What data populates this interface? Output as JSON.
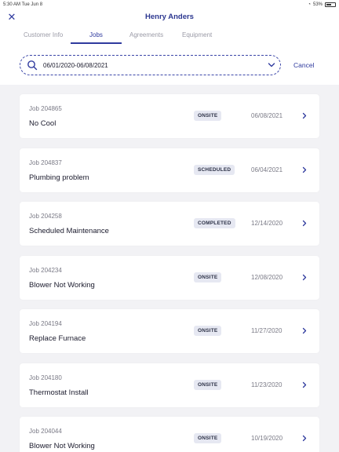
{
  "status_bar": {
    "time": "5:30 AM  Tue Jun 8",
    "battery": "53%"
  },
  "header": {
    "title": "Henry Anders"
  },
  "tabs": [
    {
      "label": "Customer Info",
      "active": false
    },
    {
      "label": "Jobs",
      "active": true
    },
    {
      "label": "Agreements",
      "active": false
    },
    {
      "label": "Equipment",
      "active": false
    }
  ],
  "search": {
    "value": "06/01/2020-06/08/2021",
    "cancel_label": "Cancel"
  },
  "jobs": [
    {
      "number": "Job 204865",
      "title": "No Cool",
      "status": "ONSITE",
      "date": "06/08/2021"
    },
    {
      "number": "Job 204837",
      "title": "Plumbing problem",
      "status": "SCHEDULED",
      "date": "06/04/2021"
    },
    {
      "number": "Job 204258",
      "title": "Scheduled Maintenance",
      "status": "COMPLETED",
      "date": "12/14/2020"
    },
    {
      "number": "Job 204234",
      "title": "Blower Not Working",
      "status": "ONSITE",
      "date": "12/08/2020"
    },
    {
      "number": "Job 204194",
      "title": "Replace Furnace",
      "status": "ONSITE",
      "date": "11/27/2020"
    },
    {
      "number": "Job 204180",
      "title": "Thermostat Install",
      "status": "ONSITE",
      "date": "11/23/2020"
    },
    {
      "number": "Job 204044",
      "title": "Blower Not Working",
      "status": "ONSITE",
      "date": "10/19/2020"
    }
  ],
  "icons": {
    "close": "close-icon",
    "search": "search-icon",
    "dropdown": "chevron-down-icon",
    "row": "chevron-right-icon"
  },
  "colors": {
    "accent": "#2f3a9e",
    "badge_bg": "#e6e8f2",
    "page_bg": "#f2f2f5"
  }
}
